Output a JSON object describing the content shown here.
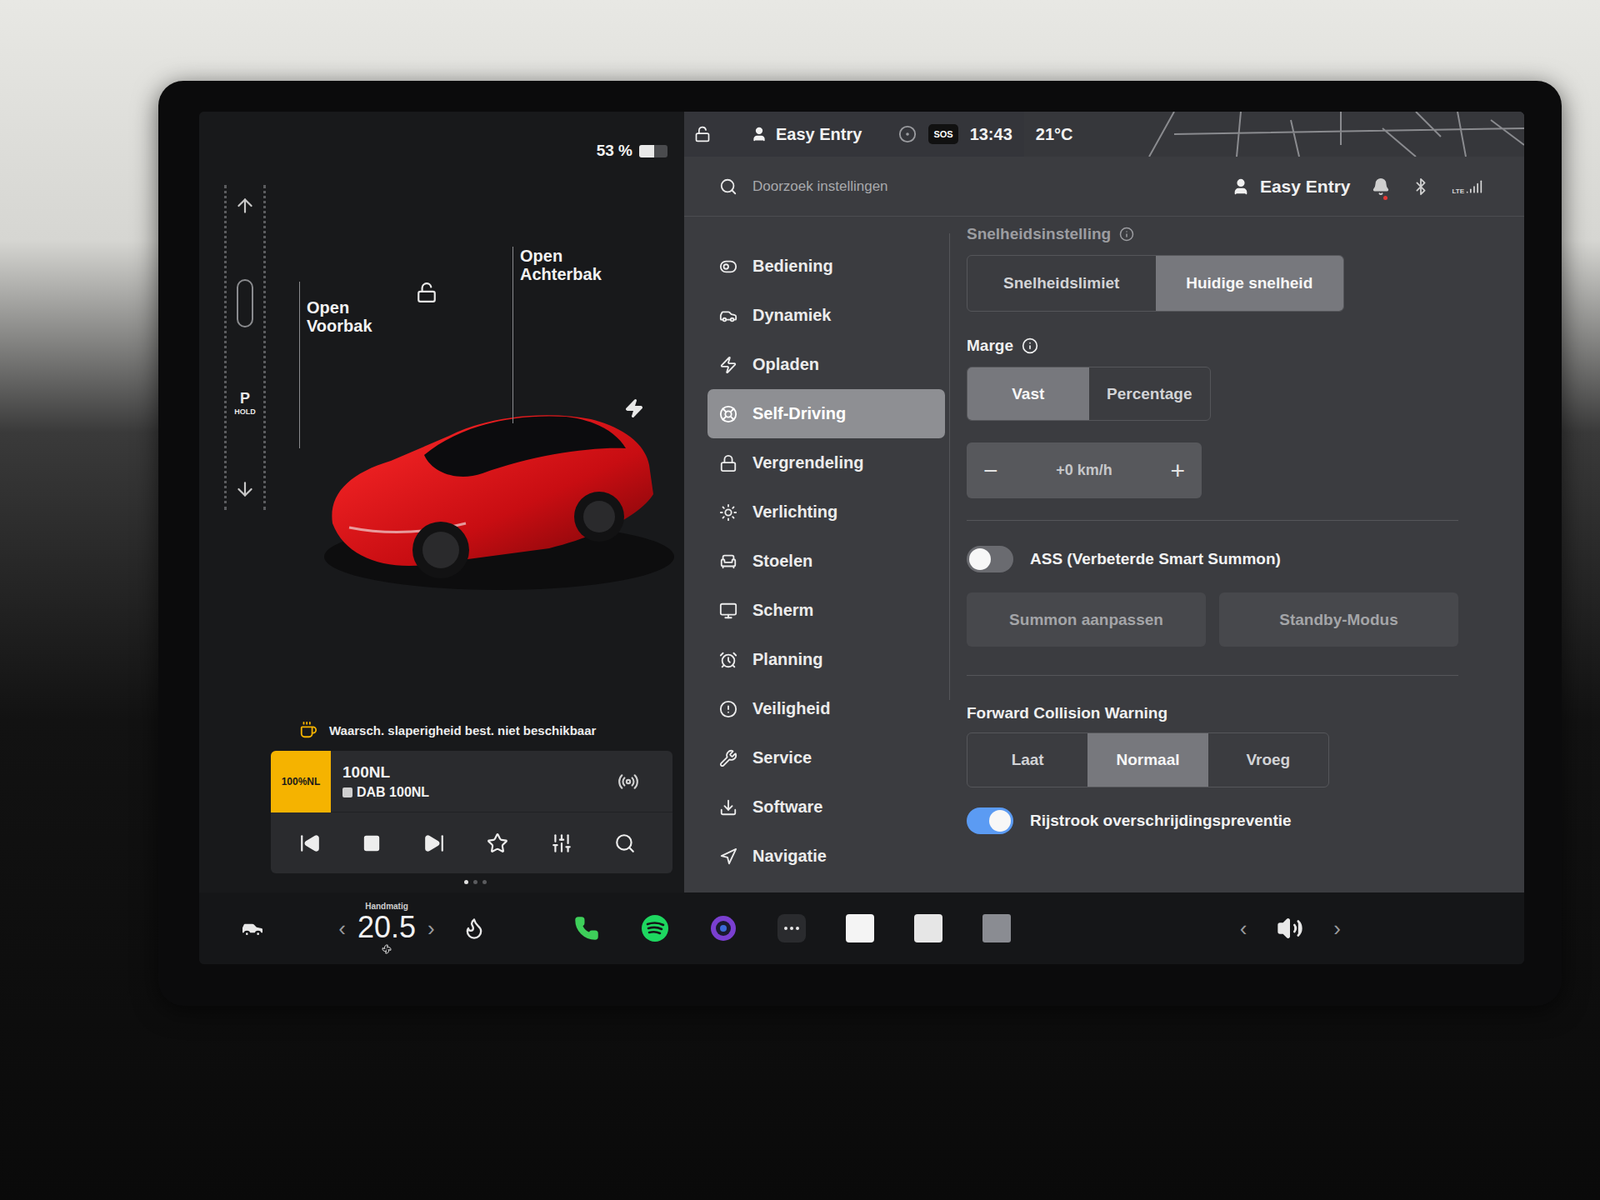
{
  "left_panel": {
    "battery": {
      "reading": "53 %",
      "level": 0.53
    },
    "gear": {
      "label": "P",
      "hold": "HOLD"
    },
    "car_labels": {
      "front_trunk": "Open Voorbak",
      "rear_trunk": "Open Achterbak"
    },
    "locked": false,
    "warning": "Waarsch. slaperigheid best. niet beschikbaar",
    "media": {
      "logo": "100%NL",
      "station": "100NL",
      "source": "DAB 100NL"
    },
    "pager": [
      {
        "selected": true
      },
      {
        "selected": false
      },
      {
        "selected": false
      }
    ]
  },
  "status_bar": {
    "locked": false,
    "profile": "Easy Entry",
    "sos": "SOS",
    "time": "13:43",
    "temperature": "21°C"
  },
  "header": {
    "search_placeholder": "Doorzoek instellingen",
    "profile": "Easy Entry",
    "notification": true,
    "network": "LTE"
  },
  "menu": [
    {
      "label": "Bediening",
      "selected": false
    },
    {
      "label": "Dynamiek",
      "selected": false
    },
    {
      "label": "Opladen",
      "selected": false
    },
    {
      "label": "Self-Driving",
      "selected": true
    },
    {
      "label": "Vergrendeling",
      "selected": false
    },
    {
      "label": "Verlichting",
      "selected": false
    },
    {
      "label": "Stoelen",
      "selected": false
    },
    {
      "label": "Scherm",
      "selected": false
    },
    {
      "label": "Planning",
      "selected": false
    },
    {
      "label": "Veiligheid",
      "selected": false
    },
    {
      "label": "Service",
      "selected": false
    },
    {
      "label": "Software",
      "selected": false
    },
    {
      "label": "Navigatie",
      "selected": false
    }
  ],
  "settings": {
    "speed_setting": {
      "label": "Snelheidsinstelling",
      "options": [
        {
          "label": "Snelheidslimiet",
          "selected": false
        },
        {
          "label": "Huidige snelheid",
          "selected": true
        }
      ]
    },
    "margin": {
      "label": "Marge",
      "options": [
        {
          "label": "Vast",
          "selected": true
        },
        {
          "label": "Percentage",
          "selected": false
        }
      ],
      "minus": "−",
      "value": "+0 km/h",
      "plus": "+"
    },
    "summon": {
      "label": "ASS (Verbeterde Smart Summon)",
      "on": false,
      "buttons": [
        {
          "label": "Summon aanpassen",
          "disabled": true
        },
        {
          "label": "Standby-Modus",
          "disabled": true
        }
      ]
    },
    "fcw": {
      "label": "Forward Collision Warning",
      "options": [
        {
          "label": "Laat",
          "selected": false
        },
        {
          "label": "Normaal",
          "selected": true
        },
        {
          "label": "Vroeg",
          "selected": false
        }
      ]
    },
    "lane": {
      "label": "Rijstrook overschrijdingspreventie",
      "on": true
    }
  },
  "bottom_bar": {
    "climate_mode": "Handmatig",
    "temperature": "20.5",
    "prev": "‹",
    "next": "›",
    "volume_prev": "‹",
    "volume_next": "›"
  }
}
